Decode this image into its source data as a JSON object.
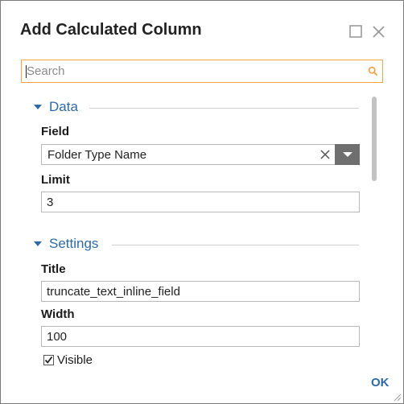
{
  "dialog": {
    "title": "Add Calculated Column",
    "ok_label": "OK"
  },
  "search": {
    "placeholder": "Search",
    "value": ""
  },
  "sections": {
    "data": {
      "label": "Data",
      "expanded": true,
      "field_label": "Field",
      "field_value": "Folder Type Name",
      "limit_label": "Limit",
      "limit_value": "3"
    },
    "settings": {
      "label": "Settings",
      "expanded": true,
      "title_label": "Title",
      "title_value": "truncate_text_inline_field",
      "width_label": "Width",
      "width_value": "100",
      "visible_label": "Visible",
      "visible_checked": true
    }
  },
  "icons": {
    "maximize": "maximize-icon",
    "close": "close-icon",
    "search": "search-icon",
    "collapse": "triangle-down-icon",
    "clear": "clear-x-icon",
    "dropdown": "dropdown-arrow-icon",
    "check": "checkmark-icon",
    "resize": "resize-grip-icon"
  },
  "colors": {
    "accent": "#2f6aa6",
    "search_border": "#f0a44a",
    "dropdown_button": "#6f6f6f"
  }
}
